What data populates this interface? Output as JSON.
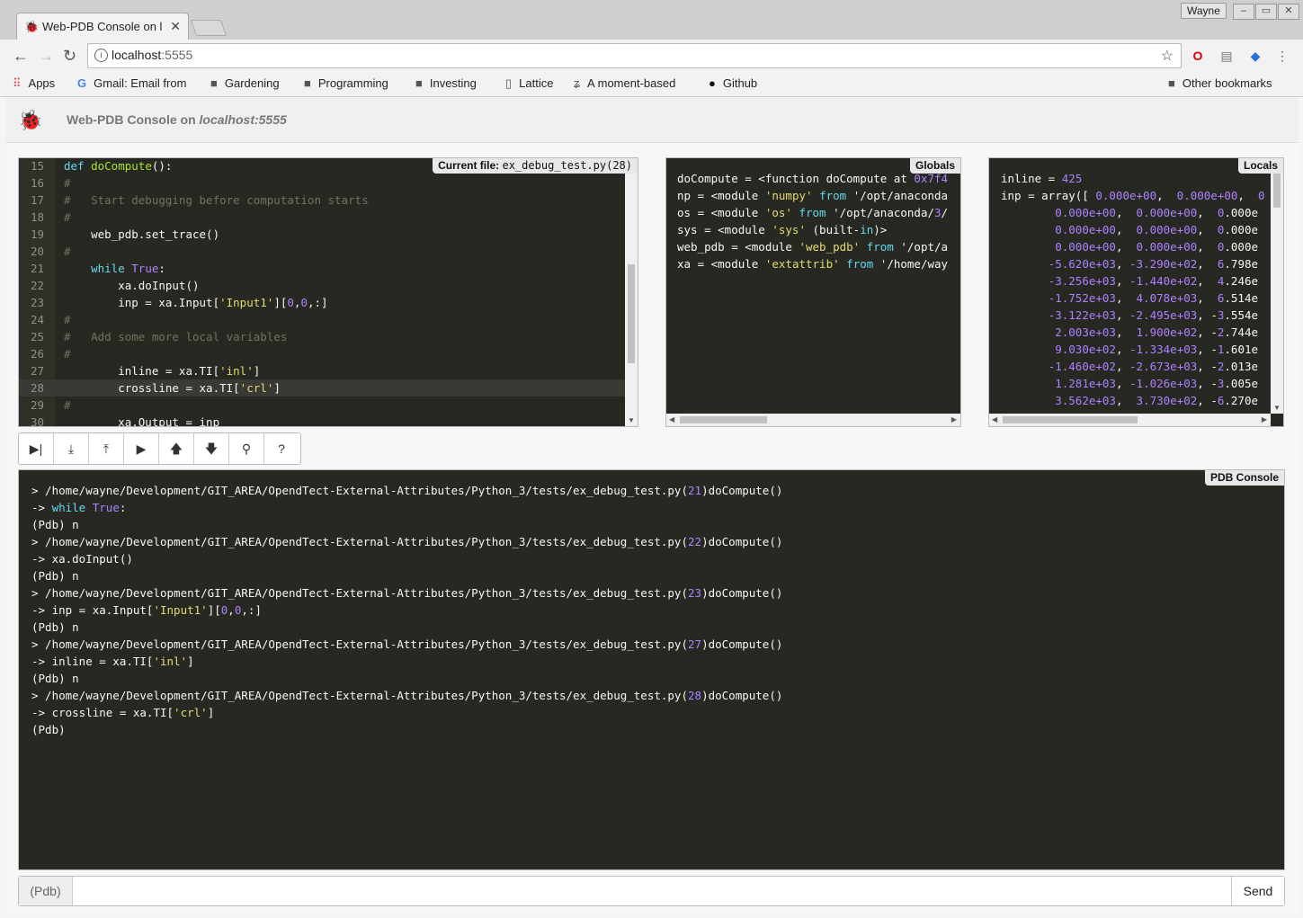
{
  "browser": {
    "tab_title": "Web-PDB Console on l",
    "user": "Wayne",
    "url_host": "localhost",
    "url_port": ":5555",
    "bookmarks": [
      "Apps",
      "Gmail: Email from",
      "Gardening",
      "Programming",
      "Investing",
      "Lattice",
      "A moment-based",
      "Github"
    ],
    "other_bookmarks": "Other bookmarks"
  },
  "header": {
    "title_prefix": "Web-PDB Console on",
    "title_host": "localhost:5555"
  },
  "code_panel": {
    "label": "Current file:",
    "file": "ex_debug_test.py(28)",
    "current_line": 28,
    "lines": [
      {
        "n": "15",
        "t": "def doCompute():"
      },
      {
        "n": "16",
        "t": "#"
      },
      {
        "n": "17",
        "t": "#   Start debugging before computation starts"
      },
      {
        "n": "18",
        "t": "#"
      },
      {
        "n": "19",
        "t": "    web_pdb.set_trace()"
      },
      {
        "n": "20",
        "t": "#"
      },
      {
        "n": "21",
        "t": "    while True:"
      },
      {
        "n": "22",
        "t": "        xa.doInput()"
      },
      {
        "n": "23",
        "t": "        inp = xa.Input['Input1'][0,0,:]"
      },
      {
        "n": "24",
        "t": "#"
      },
      {
        "n": "25",
        "t": "#   Add some more local variables"
      },
      {
        "n": "26",
        "t": "#"
      },
      {
        "n": "27",
        "t": "        inline = xa.TI['inl']"
      },
      {
        "n": "28",
        "t": "        crossline = xa.TI['crl']"
      },
      {
        "n": "29",
        "t": "#"
      },
      {
        "n": "30",
        "t": "        xa.Output = inp"
      }
    ]
  },
  "globals_panel": {
    "label": "Globals",
    "lines": [
      "doCompute = <function doCompute at 0x7f4",
      "np = <module 'numpy' from '/opt/anaconda",
      "os = <module 'os' from '/opt/anaconda/3/",
      "sys = <module 'sys' (built-in)>",
      "web_pdb = <module 'web_pdb' from '/opt/a",
      "xa = <module 'extattrib' from '/home/way"
    ]
  },
  "locals_panel": {
    "label": "Locals",
    "lines": [
      "inline = 425",
      "inp = array([ 0.000e+00,  0.000e+00,  0",
      "        0.000e+00,  0.000e+00,  0.000e",
      "        0.000e+00,  0.000e+00,  0.000e",
      "        0.000e+00,  0.000e+00,  0.000e",
      "       -5.620e+03, -3.290e+02,  6.798e",
      "       -3.256e+03, -1.440e+02,  4.246e",
      "       -1.752e+03,  4.078e+03,  6.514e",
      "       -3.122e+03, -2.495e+03, -3.554e",
      "        2.003e+03,  1.900e+02, -2.744e",
      "        9.030e+02, -1.334e+03, -1.601e",
      "       -1.460e+02, -2.673e+03, -2.013e",
      "        1.281e+03, -1.026e+03, -3.005e",
      "        3.562e+03,  3.730e+02, -6.270e"
    ]
  },
  "toolbar_buttons": [
    {
      "name": "next-button",
      "glyph": "▶|"
    },
    {
      "name": "step-button",
      "glyph": "⤓"
    },
    {
      "name": "return-button",
      "glyph": "⤒"
    },
    {
      "name": "continue-button",
      "glyph": "▶"
    },
    {
      "name": "up-button",
      "glyph": "🡅"
    },
    {
      "name": "down-button",
      "glyph": "🡇"
    },
    {
      "name": "where-button",
      "glyph": "⚲"
    },
    {
      "name": "help-button",
      "glyph": "?"
    }
  ],
  "console": {
    "label": "PDB Console",
    "path": "/home/wayne/Development/GIT_AREA/OpendTect-External-Attributes/Python_3/tests/ex_debug_test.py",
    "lines": [
      {
        "k": "loc",
        "n": "21"
      },
      {
        "k": "arrow",
        "t": "while True:"
      },
      {
        "k": "pdb",
        "t": "(Pdb) n"
      },
      {
        "k": "loc",
        "n": "22"
      },
      {
        "k": "arrow",
        "t": "xa.doInput()"
      },
      {
        "k": "pdb",
        "t": "(Pdb) n"
      },
      {
        "k": "loc",
        "n": "23"
      },
      {
        "k": "arrow",
        "t": "inp = xa.Input['Input1'][0,0,:]"
      },
      {
        "k": "pdb",
        "t": "(Pdb) n"
      },
      {
        "k": "loc",
        "n": "27"
      },
      {
        "k": "arrow",
        "t": "inline = xa.TI['inl']"
      },
      {
        "k": "pdb",
        "t": "(Pdb) n"
      },
      {
        "k": "loc",
        "n": "28"
      },
      {
        "k": "arrow",
        "t": "crossline = xa.TI['crl']"
      },
      {
        "k": "pdb",
        "t": "(Pdb)"
      }
    ]
  },
  "input": {
    "prompt": "(Pdb)",
    "value": "",
    "send_label": "Send"
  }
}
